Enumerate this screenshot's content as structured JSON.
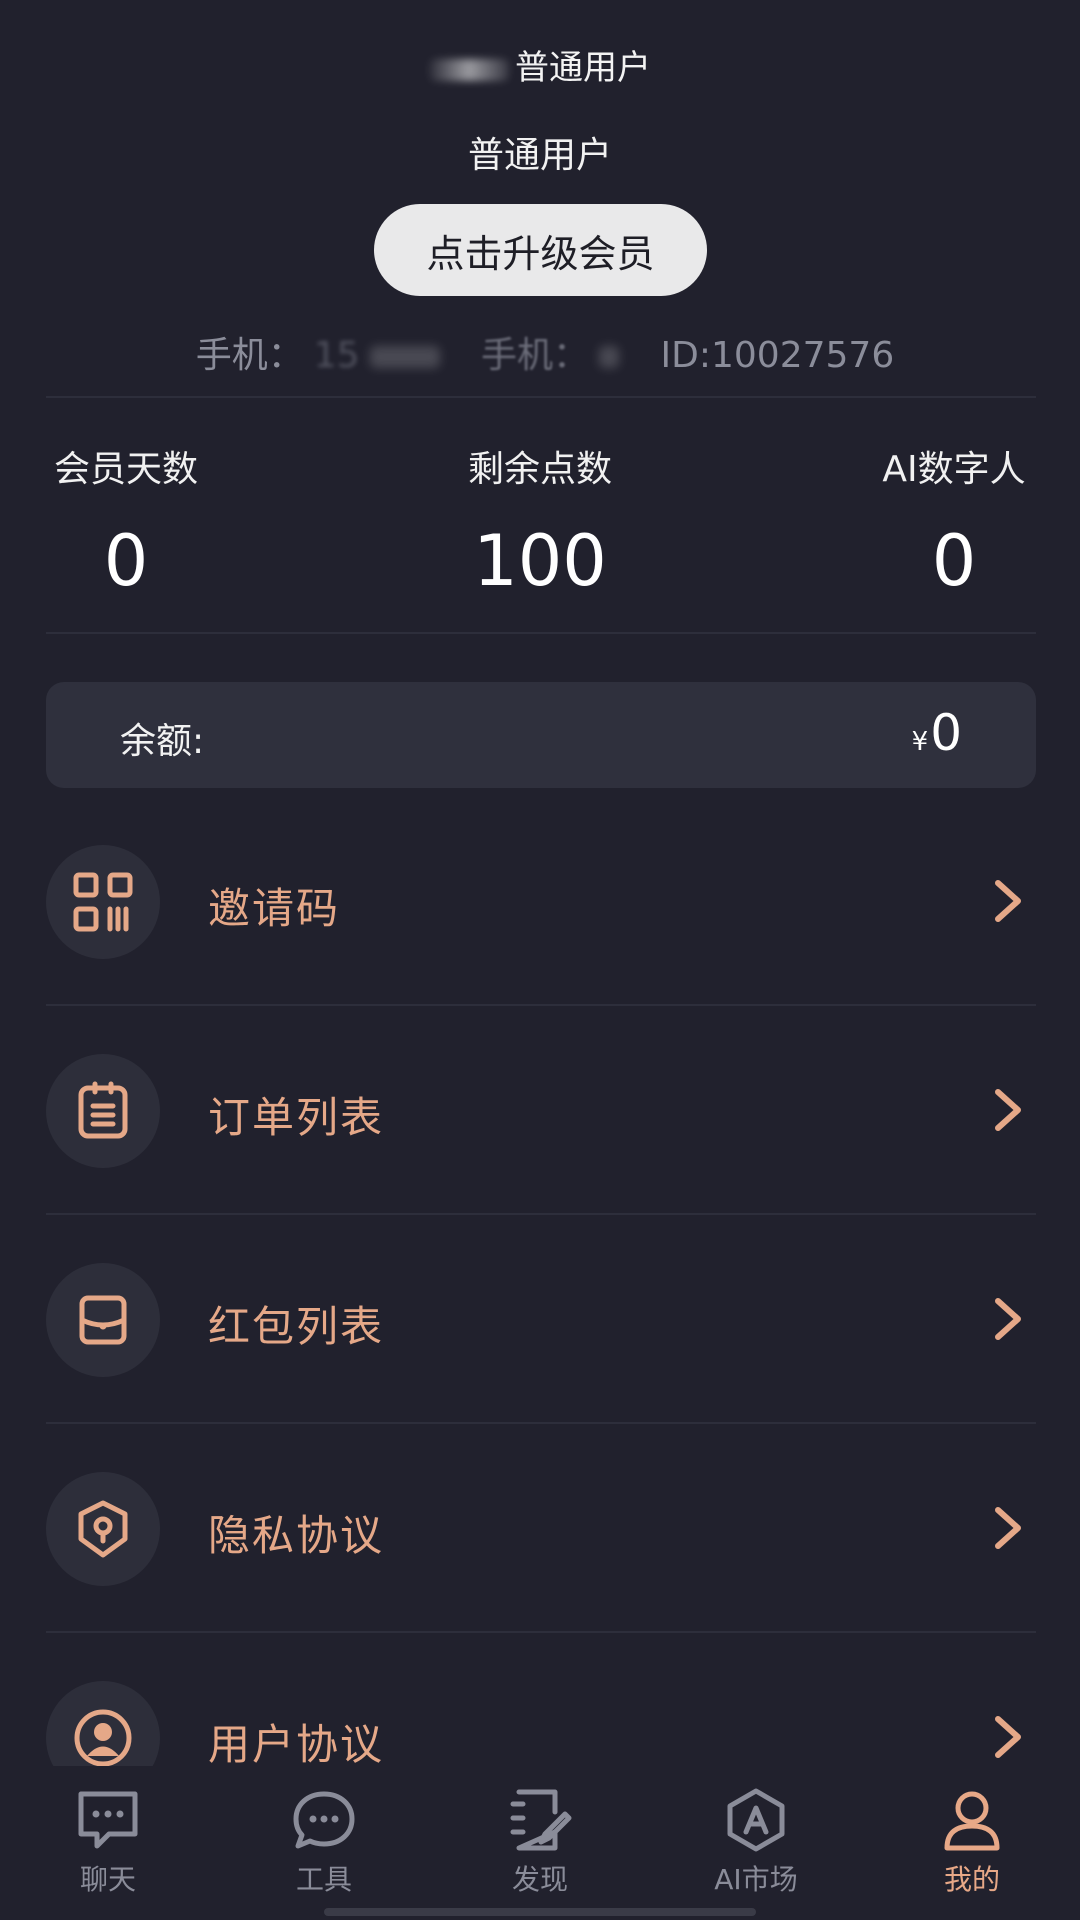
{
  "header": {
    "top_name": "普通用户",
    "user_level": "普通用户",
    "upgrade_label": "点击升级会员",
    "phone_label_1": "手机：",
    "phone_value_1": "15",
    "phone_label_2": "手机：",
    "id_text": "ID:10027576"
  },
  "stats": [
    {
      "label": "会员天数",
      "value": "0"
    },
    {
      "label": "剩余点数",
      "value": "100"
    },
    {
      "label": "AI数字人",
      "value": "0"
    }
  ],
  "balance": {
    "label": "余额:",
    "currency": "¥",
    "amount": "0"
  },
  "menu": [
    {
      "label": "邀请码",
      "icon": "qr-code-icon"
    },
    {
      "label": "订单列表",
      "icon": "clipboard-list-icon"
    },
    {
      "label": "红包列表",
      "icon": "red-envelope-icon"
    },
    {
      "label": "隐私协议",
      "icon": "privacy-shield-icon"
    },
    {
      "label": "用户协议",
      "icon": "user-agreement-icon"
    }
  ],
  "tabbar": [
    {
      "label": "聊天",
      "icon": "chat-bubble-icon",
      "active": false
    },
    {
      "label": "工具",
      "icon": "tools-icon",
      "active": false
    },
    {
      "label": "发现",
      "icon": "discover-notebook-icon",
      "active": false
    },
    {
      "label": "AI市场",
      "icon": "ai-market-icon",
      "active": false
    },
    {
      "label": "我的",
      "icon": "profile-icon",
      "active": true
    }
  ],
  "colors": {
    "background": "#21212d",
    "accent": "#e5a888",
    "card": "#2f303d",
    "muted_text": "#8b8d9a"
  }
}
